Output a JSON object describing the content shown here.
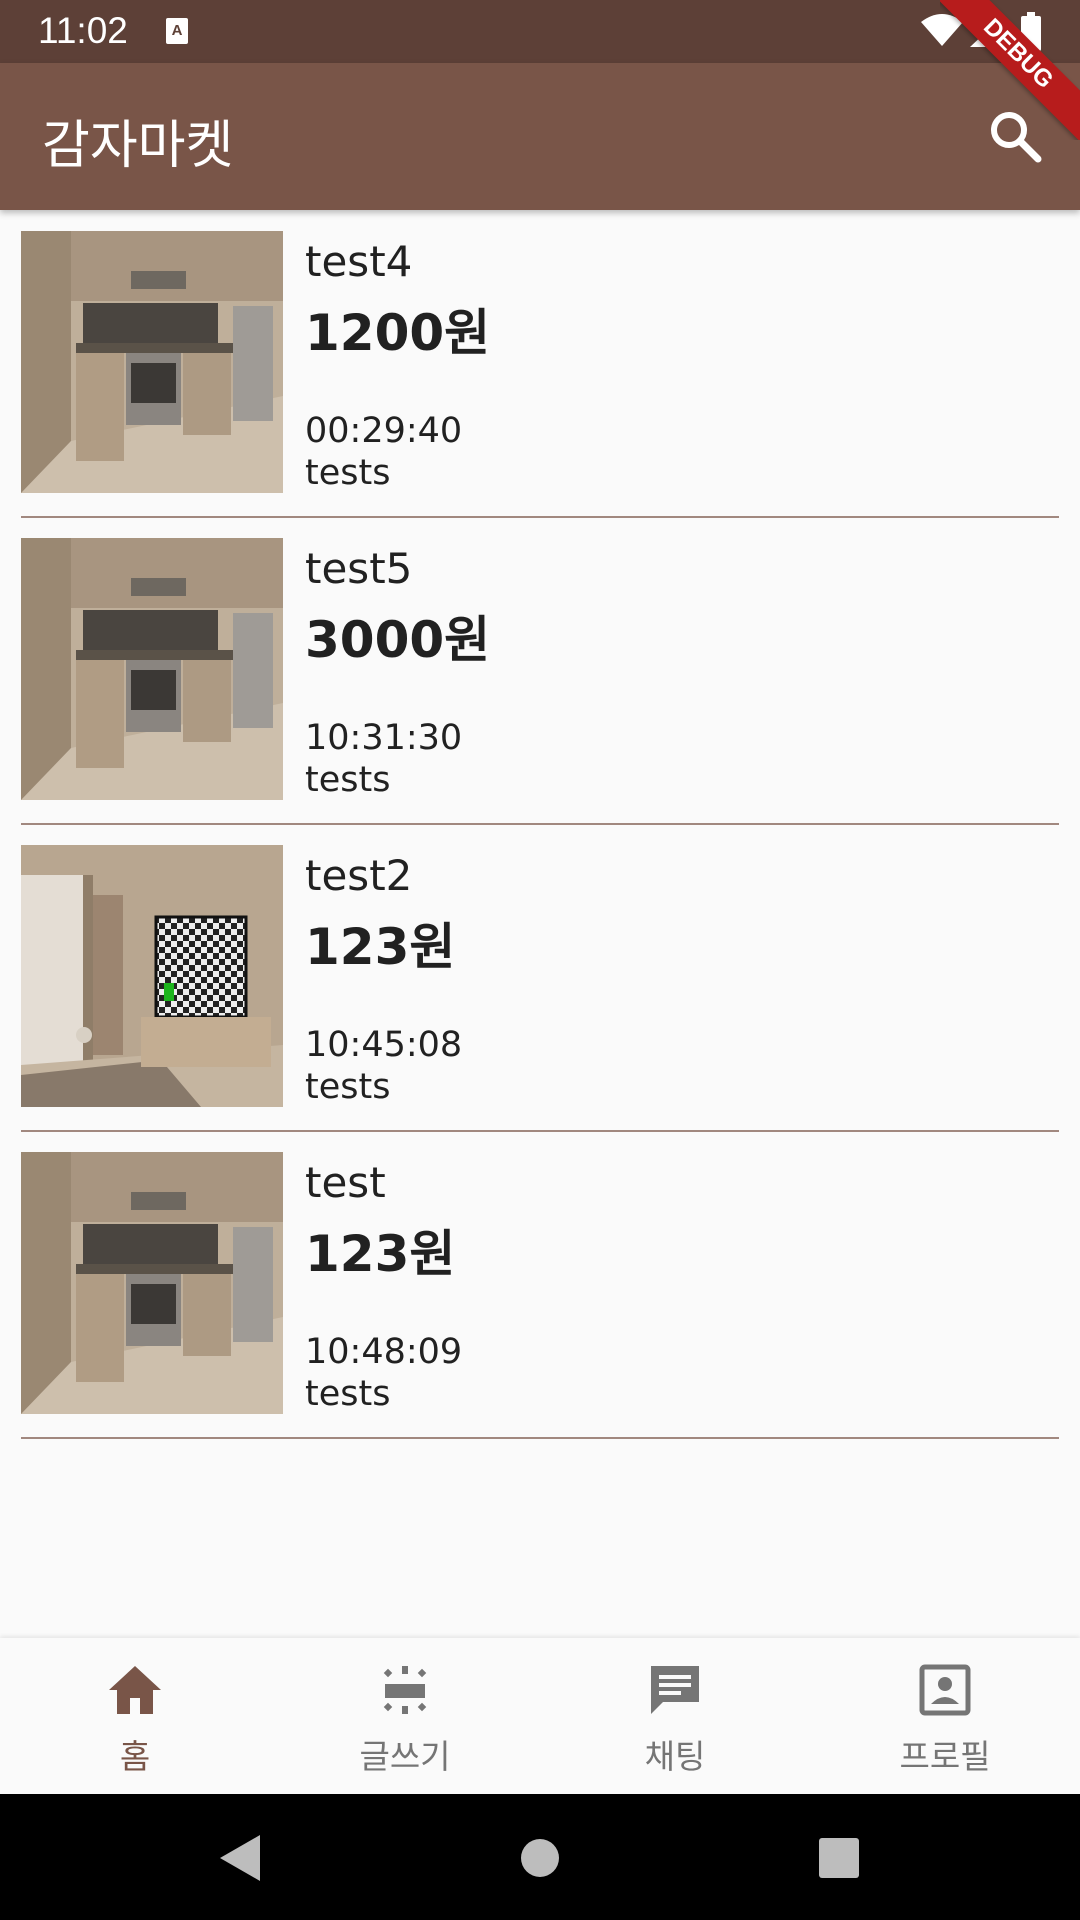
{
  "status_bar": {
    "time": "11:02"
  },
  "app_bar": {
    "title": "감자마켓"
  },
  "debug_banner": "DEBUG",
  "items": [
    {
      "title": "test4",
      "price": "1200원",
      "time": "00:29:40",
      "desc": "tests",
      "image": "kitchen"
    },
    {
      "title": "test5",
      "price": "3000원",
      "time": "10:31:30",
      "desc": "tests",
      "image": "kitchen"
    },
    {
      "title": "test2",
      "price": "123원",
      "time": "10:45:08",
      "desc": "tests",
      "image": "living-room"
    },
    {
      "title": "test",
      "price": "123원",
      "time": "10:48:09",
      "desc": "tests",
      "image": "kitchen"
    }
  ],
  "bottom_nav": {
    "items": [
      {
        "label": "홈",
        "icon": "home-icon",
        "active": true
      },
      {
        "label": "글쓰기",
        "icon": "write-icon",
        "active": false
      },
      {
        "label": "채팅",
        "icon": "chat-icon",
        "active": false
      },
      {
        "label": "프로필",
        "icon": "profile-icon",
        "active": false
      }
    ]
  },
  "colors": {
    "status_bar": "#5d4037",
    "app_bar": "#795548",
    "accent": "#795548",
    "divider": "#a1887f",
    "debug_banner": "#b71c1c"
  }
}
